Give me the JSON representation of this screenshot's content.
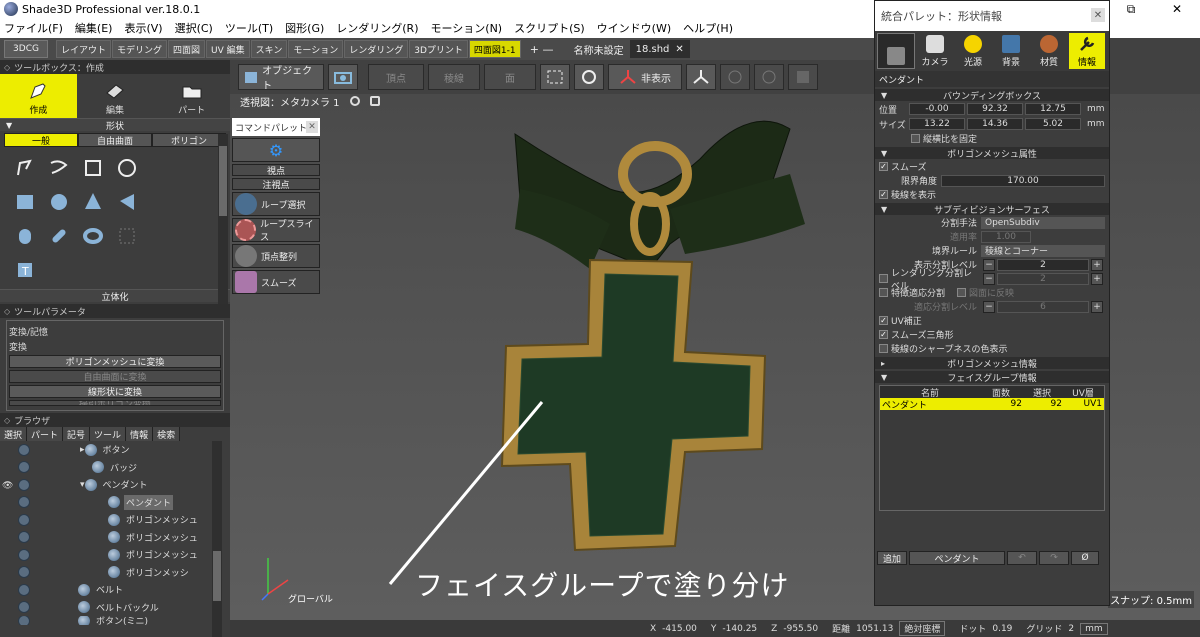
{
  "window": {
    "title": "Shade3D Professional ver.18.0.1",
    "min": "—",
    "restore": "⧉",
    "close": "✕"
  },
  "menu": [
    "ファイル(F)",
    "編集(E)",
    "表示(V)",
    "選択(C)",
    "ツール(T)",
    "図形(G)",
    "レンダリング(R)",
    "モーション(N)",
    "スクリプト(S)",
    "ウインドウ(W)",
    "ヘルプ(H)"
  ],
  "modebar": {
    "mode": "3DCG",
    "tabs": [
      "レイアウト",
      "モデリング",
      "四面図",
      "UV 編集",
      "スキン",
      "モーション",
      "レンダリング",
      "3Dプリント",
      "四面図1-1"
    ],
    "add_remove": "+ —",
    "docs": [
      "名称未設定",
      "18.shd"
    ],
    "doc_close": "✕"
  },
  "toolbox": {
    "header": "ツールボックス：作成",
    "tabs": [
      "作成",
      "編集",
      "パート"
    ],
    "shape_title": "形状",
    "shape_tabs": [
      "一般",
      "自由曲面",
      "ポリゴン"
    ],
    "next_section": "立体化"
  },
  "toolparams": {
    "header": "ツールパラメータ",
    "group": "変換/記憶",
    "sub": "変換",
    "buttons": [
      "ポリゴンメッシュに変換",
      "自由曲面に変換",
      "線形状に変換",
      "掃引ポリゴン変換"
    ]
  },
  "browser": {
    "header": "ブラウザ",
    "tabs": [
      "選択",
      "パート",
      "記号",
      "ツール",
      "情報",
      "検索"
    ],
    "items": [
      "ボタン",
      "バッジ",
      "ペンダント",
      "ペンダント",
      "ポリゴンメッシュ",
      "ポリゴンメッシュ",
      "ポリゴンメッシュ",
      "ポリゴンメッシ",
      "ベルト",
      "ベルトバックル",
      "ボタン(ミニ)"
    ]
  },
  "viewtoolbar": {
    "object": "オブジェクト",
    "vertex": "頂点",
    "edge": "稜線",
    "face": "面",
    "hide": "非表示"
  },
  "viewport": {
    "title": "透視図：メタカメラ 1",
    "caption": "フェイスグループで塗り分け",
    "axis": "グローバル",
    "snap": "スナップ: 0.5mm",
    "colors": {
      "bg": "#555555",
      "gold": "#b08a3c",
      "gem": "#1e3a25",
      "ribbon": "#1d2a16"
    }
  },
  "command_palette": {
    "title": "コマンドパレット",
    "viewpoint": "視点",
    "focus": "注視点",
    "items": [
      "ループ選択",
      "ループスライス",
      "頂点整列",
      "スムーズ"
    ]
  },
  "status": {
    "x_label": "X",
    "x": "-415.00",
    "y_label": "Y",
    "y": "-140.25",
    "z_label": "Z",
    "z": "-955.50",
    "dist_label": "距離",
    "dist": "1051.13",
    "coord": "絶対座標",
    "dot_label": "ドット",
    "dot": "0.19",
    "grid_label": "グリッド",
    "grid": "2",
    "unit": "mm"
  },
  "palette": {
    "title": "統合パレット：形状情報",
    "tabs": [
      "カメラ",
      "光源",
      "背景",
      "材質",
      "情報"
    ],
    "object_name": "ペンダント",
    "bbox_title": "バウンディングボックス",
    "bbox": {
      "pos_label": "位置",
      "pos": [
        "-0.00",
        "92.32",
        "12.75"
      ],
      "size_label": "サイズ",
      "size": [
        "13.22",
        "14.36",
        "5.02"
      ],
      "unit": "mm",
      "fix_ratio": "縦横比を固定"
    },
    "polymesh_attr_title": "ポリゴンメッシュ属性",
    "smooth": "スムーズ",
    "limit_angle_label": "限界角度",
    "limit_angle": "170.00",
    "show_edges": "稜線を表示",
    "subdiv_title": "サブディビジョンサーフェス",
    "subdiv": {
      "method_label": "分割手法",
      "method": "OpenSubdiv",
      "rate_label": "適用率",
      "rate": "1.00",
      "boundary_label": "境界ルール",
      "boundary": "稜線とコーナー",
      "display_level_label": "表示分割レベル",
      "display_level": "2",
      "render_level_label": "レンダリング分割レベル",
      "render_level": "2",
      "feature_adaptive": "特徴適応分割",
      "apply_to_render": "図面に反映",
      "adaptive_level_label": "適応分割レベル",
      "adaptive_level": "6",
      "uv_correct": "UV補正",
      "smooth_tri": "スムーズ三角形",
      "edge_sharp_color": "稜線のシャープネスの色表示",
      "minus": "−",
      "plus": "+"
    },
    "polymesh_info_title": "ポリゴンメッシュ情報",
    "facegroup_title": "フェイスグループ情報",
    "facegroup_cols": [
      "名前",
      "面数",
      "選択",
      "UV層"
    ],
    "facegroup_rows": [
      {
        "name": "ペンダント",
        "faces": "92",
        "sel": "92",
        "uv": "UV1"
      }
    ],
    "bottom": {
      "add": "追加",
      "select": "ペンダント",
      "clear": "Ø"
    }
  }
}
